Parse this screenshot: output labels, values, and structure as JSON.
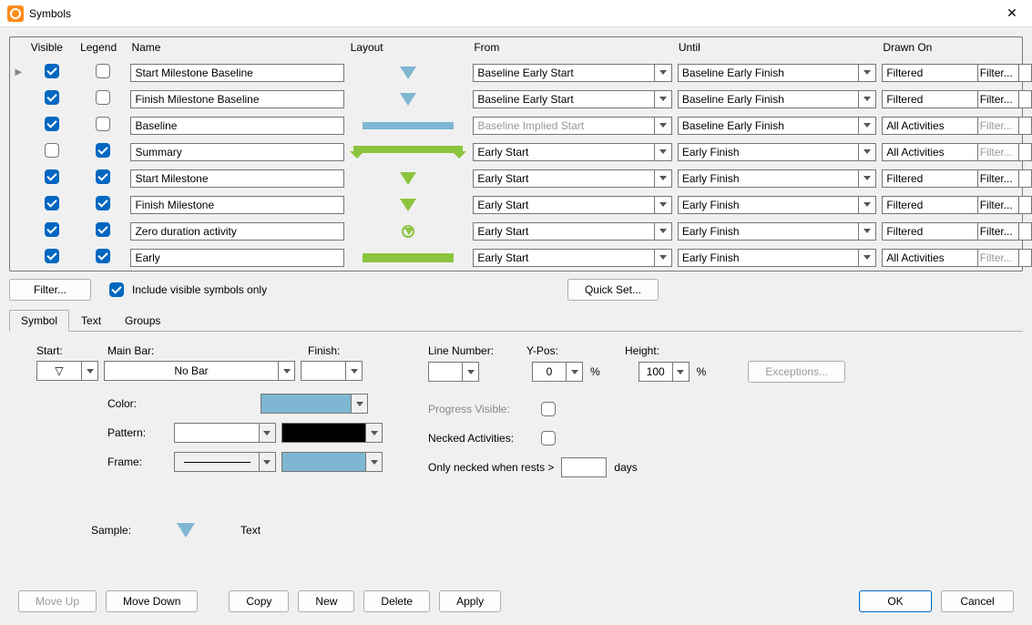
{
  "window": {
    "title": "Symbols",
    "close": "✕"
  },
  "grid": {
    "headers": {
      "visible": "Visible",
      "legend": "Legend",
      "name": "Name",
      "layout": "Layout",
      "from": "From",
      "until": "Until",
      "drawn": "Drawn On"
    },
    "filter_btn": "Filter...",
    "rows": [
      {
        "visible": true,
        "legend": false,
        "name": "Start Milestone Baseline",
        "shape": "tri-blue",
        "from": "Baseline Early Start",
        "fromDisabled": false,
        "until": "Baseline Early Finish",
        "drawn": "Filtered",
        "drawnDisabled": false
      },
      {
        "visible": true,
        "legend": false,
        "name": "Finish Milestone Baseline",
        "shape": "tri-blue",
        "from": "Baseline Early Start",
        "fromDisabled": false,
        "until": "Baseline Early Finish",
        "drawn": "Filtered",
        "drawnDisabled": false
      },
      {
        "visible": true,
        "legend": false,
        "name": "Baseline",
        "shape": "bar-blue",
        "from": "Baseline Implied Start",
        "fromDisabled": true,
        "until": "Baseline Early Finish",
        "drawn": "All Activities",
        "drawnDisabled": true
      },
      {
        "visible": false,
        "legend": true,
        "name": "Summary",
        "shape": "summary",
        "from": "Early Start",
        "fromDisabled": false,
        "until": "Early Finish",
        "drawn": "All Activities",
        "drawnDisabled": true
      },
      {
        "visible": true,
        "legend": true,
        "name": "Start Milestone",
        "shape": "tri-green",
        "from": "Early Start",
        "fromDisabled": false,
        "until": "Early Finish",
        "drawn": "Filtered",
        "drawnDisabled": false
      },
      {
        "visible": true,
        "legend": true,
        "name": "Finish Milestone",
        "shape": "tri-green",
        "from": "Early Start",
        "fromDisabled": false,
        "until": "Early Finish",
        "drawn": "Filtered",
        "drawnDisabled": false
      },
      {
        "visible": true,
        "legend": true,
        "name": "Zero duration activity",
        "shape": "zero",
        "from": "Early Start",
        "fromDisabled": false,
        "until": "Early Finish",
        "drawn": "Filtered",
        "drawnDisabled": false
      },
      {
        "visible": true,
        "legend": true,
        "name": "Early",
        "shape": "bar-green",
        "from": "Early Start",
        "fromDisabled": false,
        "until": "Early Finish",
        "drawn": "All Activities",
        "drawnDisabled": true
      }
    ]
  },
  "mid": {
    "filter": "Filter...",
    "include": "Include visible symbols only",
    "quickset": "Quick Set..."
  },
  "tabs": {
    "symbol": "Symbol",
    "text": "Text",
    "groups": "Groups"
  },
  "symbolTab": {
    "start": "Start:",
    "mainbar": "Main Bar:",
    "finish": "Finish:",
    "start_val": "▽",
    "mainbar_val": "No Bar",
    "finish_val": "",
    "color": "Color:",
    "pattern": "Pattern:",
    "frame": "Frame:",
    "color_hex": "#7fb7d3",
    "pattern_left": "#ffffff",
    "pattern_right": "#000000",
    "frame_left": "solid",
    "frame_right": "#7fb7d3",
    "line": "Line Number:",
    "line_val": "",
    "ypos": "Y-Pos:",
    "ypos_val": "0",
    "pct1": "%",
    "height": "Height:",
    "height_val": "100",
    "pct2": "%",
    "exceptions": "Exceptions...",
    "progress": "Progress Visible:",
    "necked": "Necked Activities:",
    "only_necked_pre": "Only necked when rests >",
    "only_necked_val": "",
    "only_necked_post": "days",
    "sample": "Sample:",
    "sample_text": "Text"
  },
  "bottom": {
    "moveup": "Move Up",
    "movedown": "Move Down",
    "copy": "Copy",
    "new": "New",
    "delete": "Delete",
    "apply": "Apply",
    "ok": "OK",
    "cancel": "Cancel"
  }
}
